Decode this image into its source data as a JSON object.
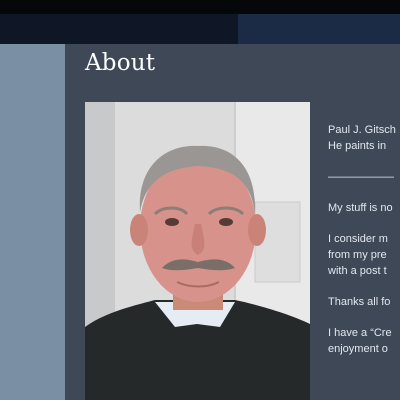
{
  "page": {
    "title": "About"
  },
  "about": {
    "intro_line1": "Paul J. Gitsch",
    "intro_line2": "He paints in",
    "divider": "——————",
    "p1": "My stuff is no",
    "p2_line1": "I consider m",
    "p2_line2": "from my pre",
    "p2_line3": "with a post t",
    "p3": "Thanks all fo",
    "p4_line1": "I have a “Cre",
    "p4_line2": "enjoyment o"
  },
  "colors": {
    "content_bg": "#3e4857",
    "sidebar_bg": "#7a8ea4",
    "nav_highlight": "#1c2b45"
  }
}
